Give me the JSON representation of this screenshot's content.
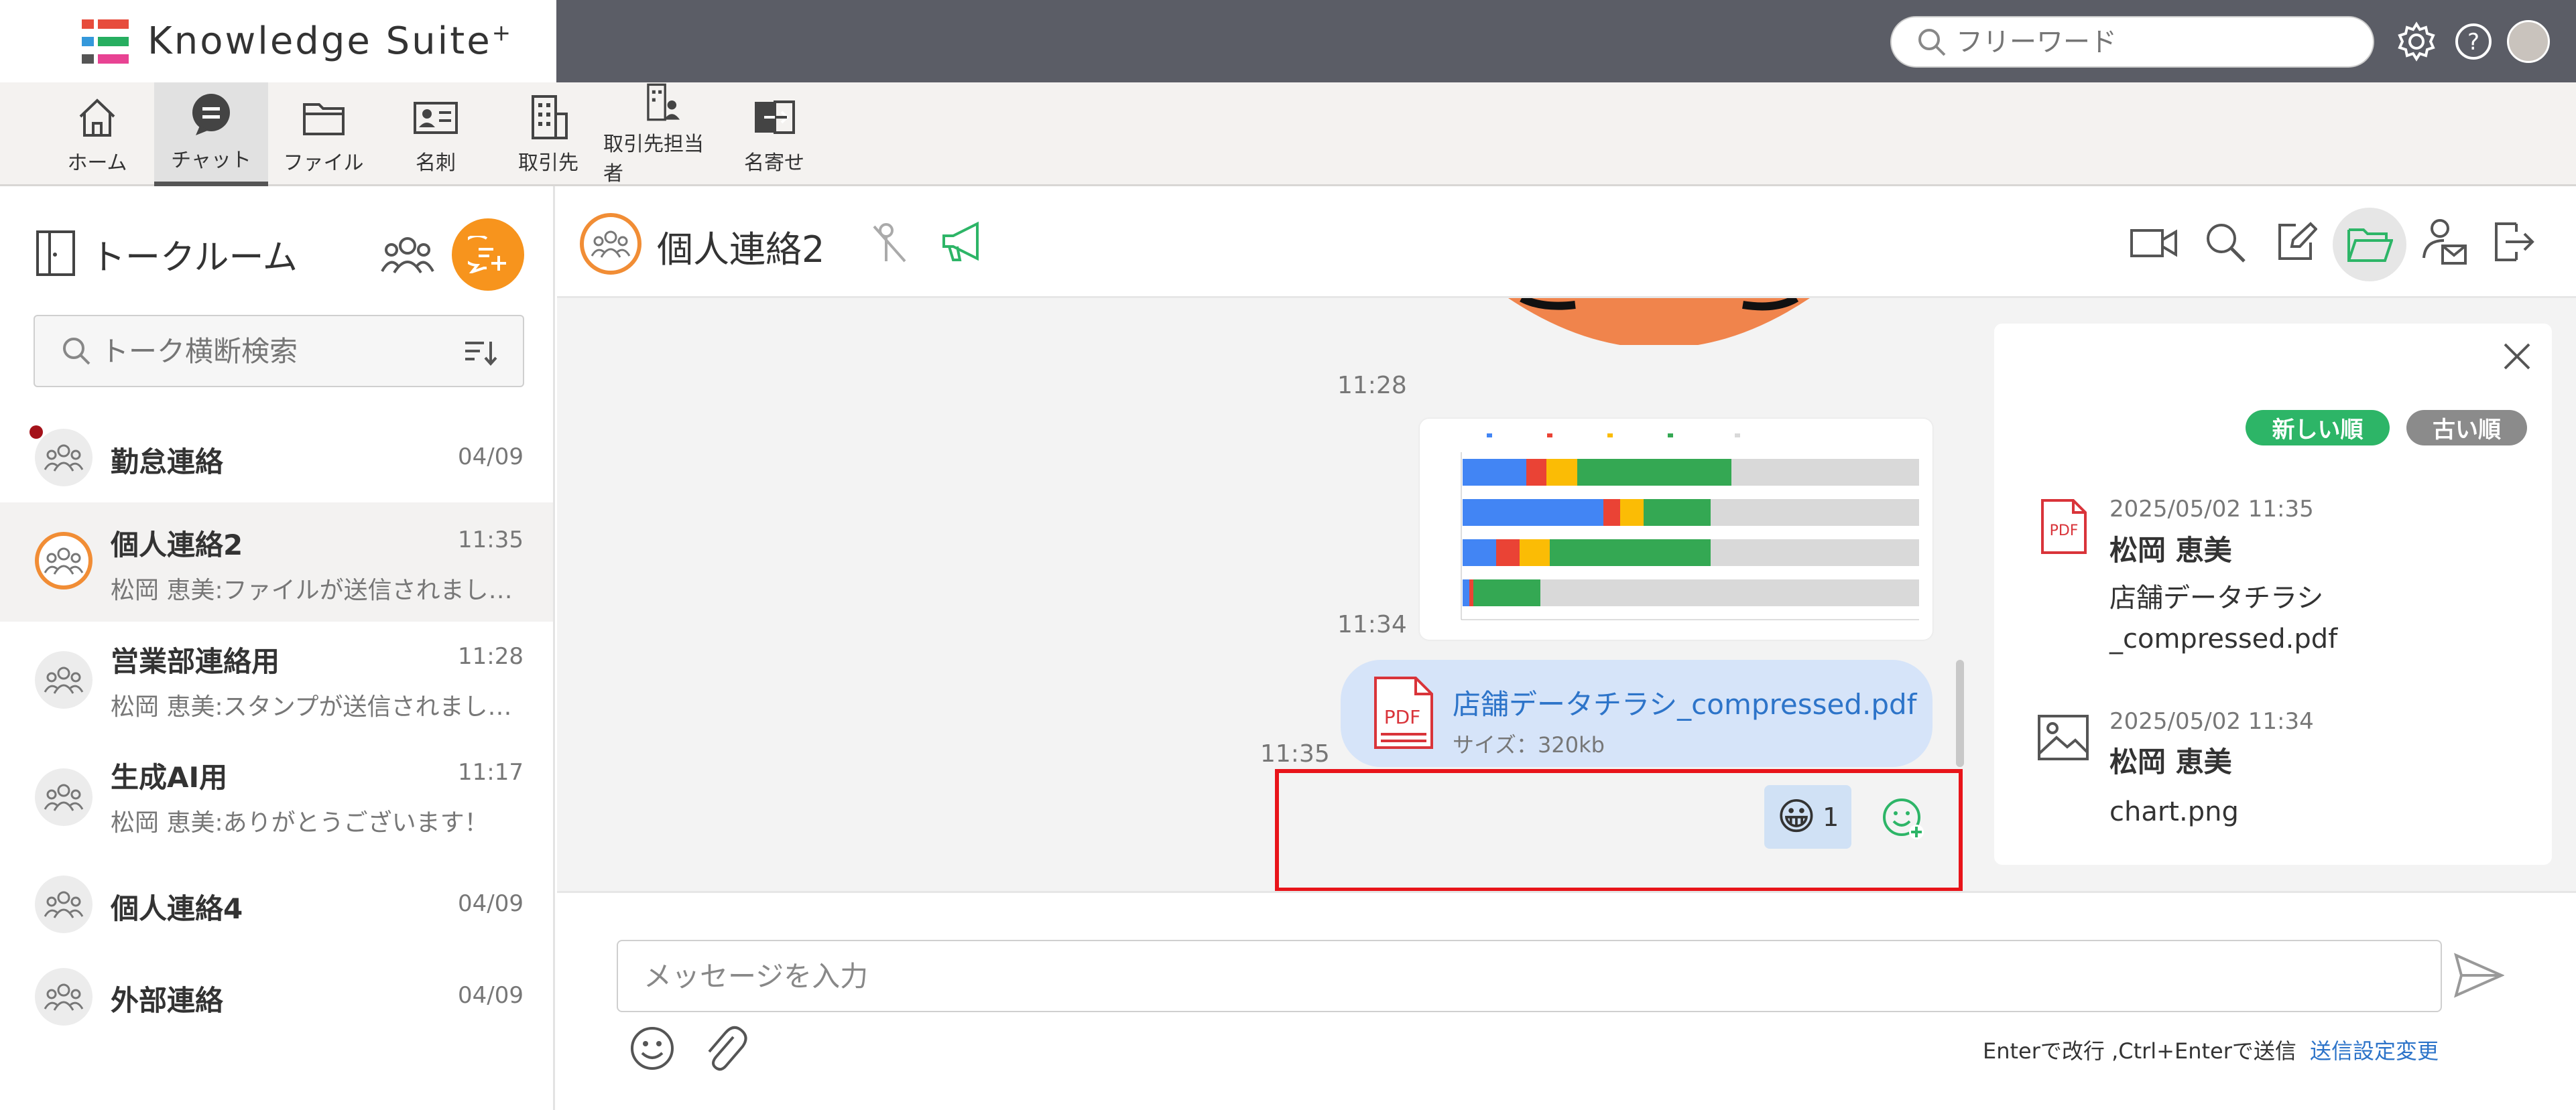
{
  "app": {
    "name": "Knowledge Suite",
    "name_suffix": "+"
  },
  "topbar": {
    "search_placeholder": "フリーワード"
  },
  "nav": {
    "items": [
      {
        "label": "ホーム",
        "icon": "home-icon"
      },
      {
        "label": "チャット",
        "icon": "chat-icon",
        "active": true
      },
      {
        "label": "ファイル",
        "icon": "folder-icon"
      },
      {
        "label": "名刺",
        "icon": "business-card-icon"
      },
      {
        "label": "取引先",
        "icon": "building-icon"
      },
      {
        "label": "取引先担当者",
        "icon": "building-person-icon"
      },
      {
        "label": "名寄せ",
        "icon": "merge-icon"
      }
    ]
  },
  "sidebar": {
    "title": "トークルーム",
    "search_placeholder": "トーク横断検索",
    "rooms": [
      {
        "name": "勤怠連絡",
        "time": "04/09",
        "preview": ""
      },
      {
        "name": "個人連絡2",
        "time": "11:35",
        "preview": "松岡 恵美:ファイルが送信されまし…"
      },
      {
        "name": "営業部連絡用",
        "time": "11:28",
        "preview": "松岡 恵美:スタンプが送信されまし…"
      },
      {
        "name": "生成AI用",
        "time": "11:17",
        "preview": "松岡 恵美:ありがとうございます！"
      },
      {
        "name": "個人連絡4",
        "time": "04/09",
        "preview": ""
      },
      {
        "name": "外部連絡",
        "time": "04/09",
        "preview": ""
      }
    ]
  },
  "chat": {
    "title": "個人連絡2",
    "messages": {
      "stamp_time": "11:28",
      "image_time": "11:34",
      "file_time": "11:35",
      "file_name": "店舗データチラシ_compressed.pdf",
      "file_size": "サイズ：320kb",
      "file_type": "PDF"
    },
    "reaction": {
      "emoji": "😀",
      "count": "1"
    },
    "input_placeholder": "メッセージを入力",
    "send_hint": "Enterで改行 ,Ctrl+Enterで送信",
    "send_setting_link": "送信設定変更"
  },
  "files_panel": {
    "sort_new": "新しい順",
    "sort_old": "古い順",
    "files": [
      {
        "date": "2025/05/02 11:35",
        "user": "松岡 恵美",
        "name_line1": "店舗データチラシ",
        "name_line2": "_compressed.pdf",
        "type": "PDF"
      },
      {
        "date": "2025/05/02 11:34",
        "user": "松岡 恵美",
        "name_line1": "chart.png",
        "type": "image"
      }
    ]
  },
  "colors": {
    "topbar": "#5b5d66",
    "accent_orange": "#f18d35",
    "sort_green": "#2db567",
    "sort_gray": "#8b8b8b",
    "link_blue": "#2d74c9",
    "highlight_red": "#e8141a"
  }
}
